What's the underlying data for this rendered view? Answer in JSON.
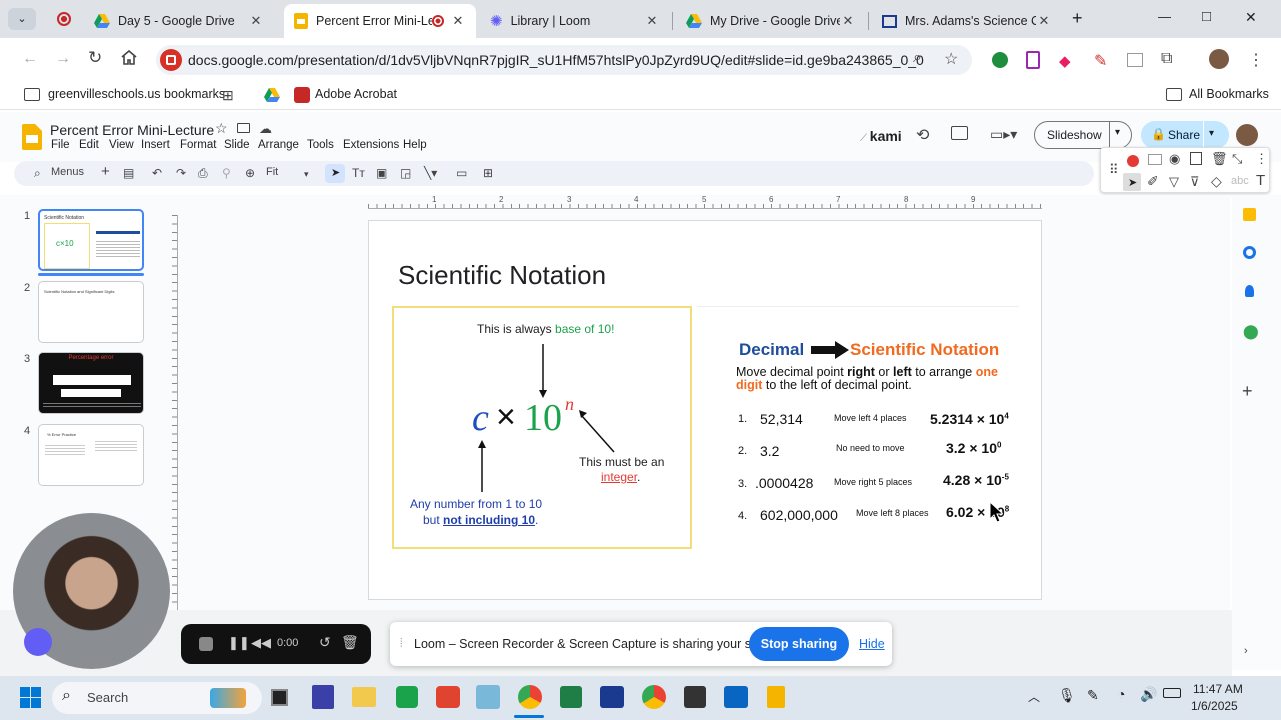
{
  "tabs": [
    {
      "title": "Day 5 - Google Drive",
      "close": "✕"
    },
    {
      "title": "Percent Error Mini-Lec",
      "close": "✕"
    },
    {
      "title": "Library | Loom",
      "close": "✕"
    },
    {
      "title": "My Drive - Google Drive",
      "close": "✕"
    },
    {
      "title": "Mrs. Adams's Science Clas",
      "close": "✕"
    }
  ],
  "window_controls": {
    "minimize": "—",
    "maximize": "□",
    "close": "✕",
    "new_tab": "+"
  },
  "url": "docs.google.com/presentation/d/1dv5VljbVNqnR7pjgIR_sU1HfM57htslPy0JpZyrd9UQ/edit#slide=id.ge9ba243865_0_0",
  "bookmarks": {
    "items": [
      "greenvilleschools.us bookmarks",
      "Adobe Acrobat"
    ],
    "all": "All Bookmarks"
  },
  "doc": {
    "title": "Percent Error Mini-Lecture",
    "menus": [
      "File",
      "Edit",
      "View",
      "Insert",
      "Format",
      "Slide",
      "Arrange",
      "Tools",
      "Extensions",
      "Help"
    ],
    "kami": "kami",
    "slideshow": "Slideshow",
    "share": "Share"
  },
  "toolbar": {
    "menus": "Menus",
    "zoom": "Fit"
  },
  "ruler": [
    "1",
    "2",
    "3",
    "4",
    "5",
    "6",
    "7",
    "8",
    "9"
  ],
  "thumbnails": [
    {
      "num": "1",
      "title": "Scientific Notation"
    },
    {
      "num": "2",
      "title": "Scientific Notation and Significant Digits"
    },
    {
      "num": "3",
      "title": "Percentage error"
    },
    {
      "num": "4",
      "title": "% Error Practice"
    }
  ],
  "slide": {
    "title": "Scientific Notation",
    "left": {
      "top_note_a": "This is always ",
      "top_note_b": "base of 10!",
      "c": "c",
      "times": "×",
      "ten": "10",
      "n": "n",
      "right_note_a": "This must be an",
      "right_note_b": "integer",
      "right_note_c": ".",
      "bottom_a": "Any number from 1 to 10",
      "bottom_b": "but ",
      "bottom_c": "not including 10",
      "bottom_d": "."
    },
    "right": {
      "decimal": "Decimal",
      "sci": "Scientific Notation",
      "instr_1": "Move decimal point ",
      "instr_right": "right",
      "instr_or": " or ",
      "instr_left": "left",
      "instr_2": " to arrange ",
      "instr_one": "one digit",
      "instr_3": " to the left of decimal point.",
      "rows": [
        {
          "n": "1.",
          "value": "52,314",
          "note": "Move left 4 places",
          "base": "5.2314 × 10",
          "exp": "4"
        },
        {
          "n": "2.",
          "value": "3.2",
          "note": "No need to move",
          "base": "3.2 × 10",
          "exp": "0"
        },
        {
          "n": "3.",
          "value": ".0000428",
          "note": "Move right 5 places",
          "base": "4.28 × 10",
          "exp": "-5"
        },
        {
          "n": "4.",
          "value": "602,000,000",
          "note": "Move left 8 places",
          "base": "6.02 × 10",
          "exp": "8"
        }
      ]
    }
  },
  "loom": {
    "time": "0:00",
    "message": "Loom – Screen Recorder & Screen Capture is sharing your screen.",
    "stop": "Stop sharing",
    "hide": "Hide"
  },
  "taskbar": {
    "search": "Search",
    "time": "11:47 AM",
    "date": "1/6/2025"
  },
  "colors": {
    "green": "#1aa34a",
    "red": "#e53935",
    "orange": "#f06a1f",
    "blue_dark": "#1f4e9c",
    "share_bg": "#c2e7ff",
    "slides_yellow": "#f4b400"
  }
}
